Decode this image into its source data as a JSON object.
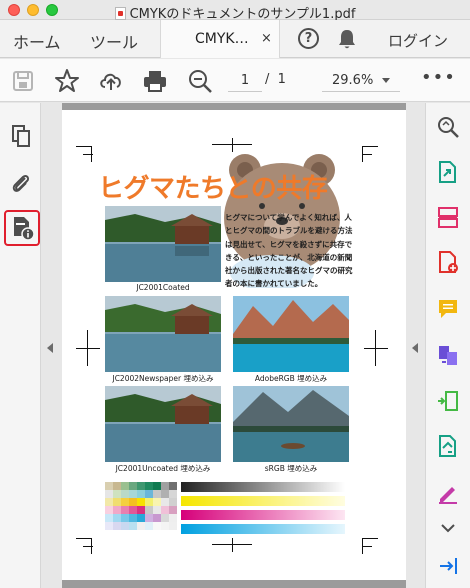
{
  "window": {
    "title": "CMYKのドキュメントのサンプル1.pdf"
  },
  "tabs": {
    "home": "ホーム",
    "tools": "ツール",
    "document_tab": "CMYK…",
    "close": "×",
    "help": "?",
    "login": "ログイン"
  },
  "toolbar": {
    "page_current": "1",
    "page_separator": "/",
    "page_total": "1",
    "zoom": "29.6%",
    "more": "•••"
  },
  "pdf": {
    "headline": "ヒグマたちとの共存",
    "body": "ヒグマについて学んでよく知れば、人とヒグマの間のトラブルを避ける方法は見出せて、ヒグマを殺さずに共存できる、といったことが、北海道の新聞社から出版された著名なヒグマの研究者の本に書かれていました。",
    "captions": [
      "JC2001Coated",
      "JC2002Newspaper 埋め込み",
      "AdobeRGB 埋め込み",
      "JC2001Uncoated 埋め込み",
      "sRGB 埋め込み"
    ]
  },
  "colors": {
    "accent_red": "#e01e2d",
    "headline_orange": "#ef7a2a",
    "rail_bg": "#f5f5f5"
  },
  "icons": {
    "left_rail": [
      "pages-icon",
      "attachment-icon",
      "document-properties-icon"
    ],
    "right_rail": [
      "zoom-icon",
      "export-pdf-icon",
      "organize-pages-icon",
      "create-pdf-icon",
      "comment-icon",
      "combine-files-icon",
      "compress-pdf-icon",
      "edit-pdf-icon",
      "fill-sign-icon",
      "chevron-down-icon",
      "collapse-panel-icon"
    ]
  }
}
